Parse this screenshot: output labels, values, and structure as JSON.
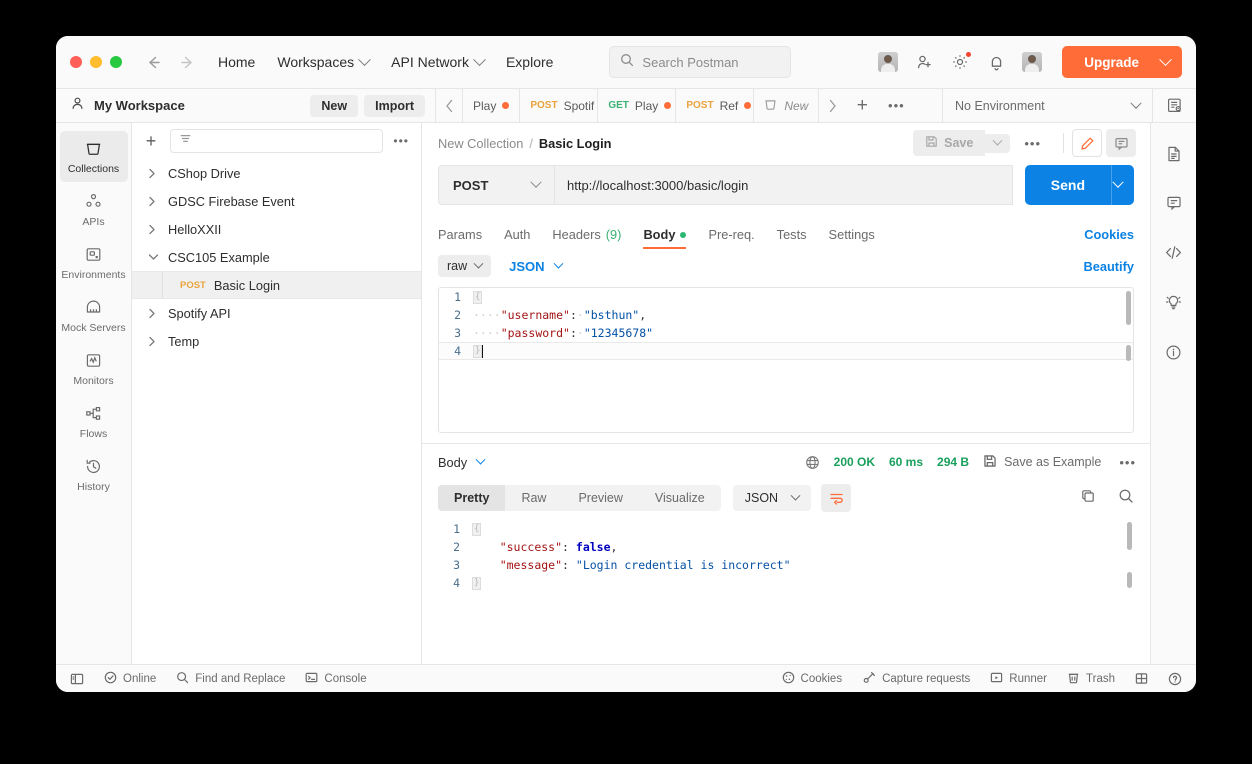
{
  "topbar": {
    "back_icon": "arrow-left-icon",
    "forward_icon": "arrow-right-icon",
    "menu": [
      {
        "label": "Home",
        "has_caret": false
      },
      {
        "label": "Workspaces",
        "has_caret": true
      },
      {
        "label": "API Network",
        "has_caret": true
      },
      {
        "label": "Explore",
        "has_caret": false
      }
    ],
    "search_placeholder": "Search Postman",
    "upgrade_label": "Upgrade",
    "accent_color": "#ff6c37"
  },
  "workspace": {
    "name": "My Workspace",
    "new_label": "New",
    "import_label": "Import"
  },
  "tabs": {
    "items": [
      {
        "verb": "",
        "title": "Play",
        "unsaved": true
      },
      {
        "verb": "POST",
        "title": "Spotif",
        "unsaved": false
      },
      {
        "verb": "GET",
        "title": "Play",
        "unsaved": true
      },
      {
        "verb": "POST",
        "title": "Ref",
        "unsaved": true
      },
      {
        "verb": "",
        "title": "New",
        "unsaved": false,
        "is_new": true
      }
    ]
  },
  "environment": {
    "selected": "No Environment"
  },
  "rail": {
    "items": [
      {
        "label": "Collections",
        "icon": "collections-icon",
        "active": true
      },
      {
        "label": "APIs",
        "icon": "apis-icon",
        "active": false
      },
      {
        "label": "Environments",
        "icon": "environments-icon",
        "active": false
      },
      {
        "label": "Mock Servers",
        "icon": "mock-servers-icon",
        "active": false
      },
      {
        "label": "Monitors",
        "icon": "monitors-icon",
        "active": false
      },
      {
        "label": "Flows",
        "icon": "flows-icon",
        "active": false
      },
      {
        "label": "History",
        "icon": "history-icon",
        "active": false
      }
    ]
  },
  "sidebar": {
    "filter_placeholder": "",
    "collections": [
      {
        "name": "CShop Drive",
        "expanded": false
      },
      {
        "name": "GDSC Firebase Event",
        "expanded": false
      },
      {
        "name": "HelloXXII",
        "expanded": false
      },
      {
        "name": "CSC105 Example",
        "expanded": true
      },
      {
        "name": "Spotify API",
        "expanded": false
      },
      {
        "name": "Temp",
        "expanded": false
      }
    ],
    "selected_request": {
      "verb": "POST",
      "name": "Basic Login"
    }
  },
  "request": {
    "breadcrumb_parent": "New Collection",
    "breadcrumb_sep": "/",
    "breadcrumb_current": "Basic Login",
    "save_label": "Save",
    "method": "POST",
    "url": "http://localhost:3000/basic/login",
    "send_label": "Send",
    "tabs": [
      {
        "label": "Params",
        "active": false
      },
      {
        "label": "Auth",
        "active": false
      },
      {
        "label": "Headers",
        "count": "(9)",
        "active": false
      },
      {
        "label": "Body",
        "active": true,
        "dot": true
      },
      {
        "label": "Pre-req.",
        "active": false
      },
      {
        "label": "Tests",
        "active": false
      },
      {
        "label": "Settings",
        "active": false
      }
    ],
    "cookies_link": "Cookies",
    "body_type": "raw",
    "body_format": "JSON",
    "beautify_label": "Beautify",
    "body_lines": [
      {
        "n": "1",
        "parts": [
          {
            "t": "fold",
            "v": "{"
          }
        ]
      },
      {
        "n": "2",
        "parts": [
          {
            "t": "ws",
            "v": "····"
          },
          {
            "t": "key",
            "v": "\"username\""
          },
          {
            "t": "punc",
            "v": ":"
          },
          {
            "t": "ws",
            "v": "·"
          },
          {
            "t": "str",
            "v": "\"bsthun\""
          },
          {
            "t": "punc",
            "v": ","
          }
        ]
      },
      {
        "n": "3",
        "parts": [
          {
            "t": "ws",
            "v": "····"
          },
          {
            "t": "key",
            "v": "\"password\""
          },
          {
            "t": "punc",
            "v": ":"
          },
          {
            "t": "ws",
            "v": "·"
          },
          {
            "t": "str",
            "v": "\"12345678\""
          }
        ]
      },
      {
        "n": "4",
        "parts": [
          {
            "t": "fold",
            "v": "}"
          },
          {
            "t": "caret",
            "v": ""
          }
        ]
      }
    ]
  },
  "response": {
    "body_label": "Body",
    "status": "200 OK",
    "time": "60 ms",
    "size": "294 B",
    "save_as_example": "Save as Example",
    "views": [
      {
        "label": "Pretty",
        "active": true
      },
      {
        "label": "Raw",
        "active": false
      },
      {
        "label": "Preview",
        "active": false
      },
      {
        "label": "Visualize",
        "active": false
      }
    ],
    "format": "JSON",
    "lines": [
      {
        "n": "1",
        "parts": [
          {
            "t": "fold",
            "v": "{"
          }
        ]
      },
      {
        "n": "2",
        "parts": [
          {
            "t": "plain",
            "v": "    "
          },
          {
            "t": "key",
            "v": "\"success\""
          },
          {
            "t": "punc",
            "v": ":"
          },
          {
            "t": "plain",
            "v": " "
          },
          {
            "t": "bool",
            "v": "false"
          },
          {
            "t": "punc",
            "v": ","
          }
        ]
      },
      {
        "n": "3",
        "parts": [
          {
            "t": "plain",
            "v": "    "
          },
          {
            "t": "key",
            "v": "\"message\""
          },
          {
            "t": "punc",
            "v": ":"
          },
          {
            "t": "plain",
            "v": " "
          },
          {
            "t": "str",
            "v": "\"Login credential is incorrect\""
          }
        ]
      },
      {
        "n": "4",
        "parts": [
          {
            "t": "fold",
            "v": "}"
          }
        ]
      }
    ]
  },
  "right_rail": {
    "items": [
      {
        "icon": "documentation-icon"
      },
      {
        "icon": "comment-icon"
      },
      {
        "icon": "code-icon"
      },
      {
        "icon": "lightbulb-icon"
      },
      {
        "icon": "info-circle-icon"
      }
    ]
  },
  "statusbar": {
    "left": [
      {
        "label": "",
        "icon": "sidebar-toggle-icon"
      },
      {
        "label": "Online",
        "icon": "online-icon"
      },
      {
        "label": "Find and Replace",
        "icon": "search-icon"
      },
      {
        "label": "Console",
        "icon": "console-icon"
      }
    ],
    "right": [
      {
        "label": "Cookies",
        "icon": "cookie-icon"
      },
      {
        "label": "Capture requests",
        "icon": "capture-icon"
      },
      {
        "label": "Runner",
        "icon": "runner-icon"
      },
      {
        "label": "Trash",
        "icon": "trash-icon"
      },
      {
        "label": "",
        "icon": "layout-icon"
      },
      {
        "label": "",
        "icon": "help-icon"
      }
    ]
  }
}
